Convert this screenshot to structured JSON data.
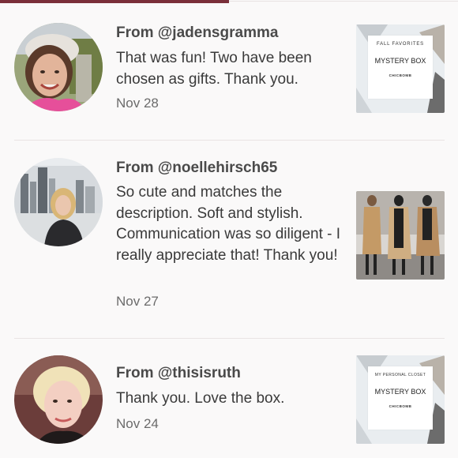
{
  "reviews": [
    {
      "from": "From @jadensgramma",
      "message": "That was fun! Two have been chosen as gifts. Thank you.",
      "date": "Nov 28",
      "thumb": {
        "top": "FALL FAVORITES",
        "main": "MYSTERY BOX",
        "brand": "CHICBOMB"
      }
    },
    {
      "from": "From @noellehirsch65",
      "message": "So cute and matches the description. Soft and stylish. Communication was so diligent - I really appreciate that! Thank you!",
      "date": "Nov 27"
    },
    {
      "from": "From @thisisruth",
      "message": "Thank you. Love the box.",
      "date": "Nov 24",
      "thumb": {
        "top": "MY PERSONAL CLOSET",
        "main": "MYSTERY BOX",
        "brand": "CHICBOMB"
      }
    }
  ],
  "colors": {
    "accent": "#7a2f3a",
    "background": "#faf9f9",
    "divider": "#e9e4e4"
  }
}
